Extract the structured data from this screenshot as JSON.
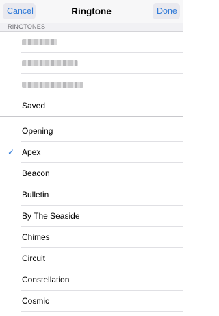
{
  "nav": {
    "cancel_label": "Cancel",
    "title": "Ringtone",
    "done_label": "Done"
  },
  "section": {
    "header": "RINGTONES"
  },
  "custom_tones": [
    {
      "label": "Saved"
    }
  ],
  "tones": [
    {
      "label": "Opening",
      "selected": false
    },
    {
      "label": "Apex",
      "selected": true
    },
    {
      "label": "Beacon",
      "selected": false
    },
    {
      "label": "Bulletin",
      "selected": false
    },
    {
      "label": "By The Seaside",
      "selected": false
    },
    {
      "label": "Chimes",
      "selected": false
    },
    {
      "label": "Circuit",
      "selected": false
    },
    {
      "label": "Constellation",
      "selected": false
    },
    {
      "label": "Cosmic",
      "selected": false
    }
  ],
  "check_glyph": "✓",
  "colors": {
    "accent": "#2f7ad8",
    "nav_background": "#f7f7f8",
    "section_background": "#f1f1f4"
  }
}
